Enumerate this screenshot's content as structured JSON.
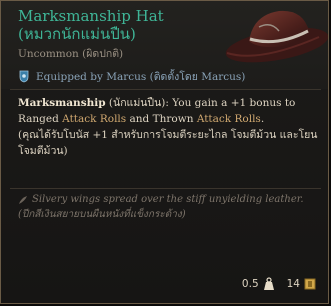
{
  "item": {
    "name": "Marksmanship Hat",
    "name_thai": "(หมวกนักแม่นปืน)",
    "rarity": "Uncommon (ผิดปกติ)",
    "equipped": "Equipped by Marcus (ติดตั้งโดย Marcus)"
  },
  "description": {
    "passive_name": "Marksmanship",
    "passive_name_thai": " (นักแม่นปืน)",
    "text_1": ": You gain a +1 bonus to Ranged ",
    "keyword_1": "Attack Rolls",
    "text_2": " and Thrown ",
    "keyword_2": "Attack Rolls",
    "text_3": ".",
    "thai": "(คุณได้รับโบนัส +1 สำหรับการโจมตีระยะไกล โจมตีม้วน และโยนโจมตีม้วน)"
  },
  "flavor": {
    "english": "Silvery wings spread over the stiff unyielding leather.",
    "thai": "(ปีกสีเงินสยายบนผืนหนังที่แข็งกระด้าง)"
  },
  "footer": {
    "weight": "0.5",
    "weight_icon": "weight-icon",
    "value": "14",
    "value_icon": "gold-coin-icon"
  },
  "colors": {
    "name": "#3fb597",
    "keyword": "#d0a870",
    "equipped": "#8aa3b8",
    "flavor": "#7d746a"
  }
}
